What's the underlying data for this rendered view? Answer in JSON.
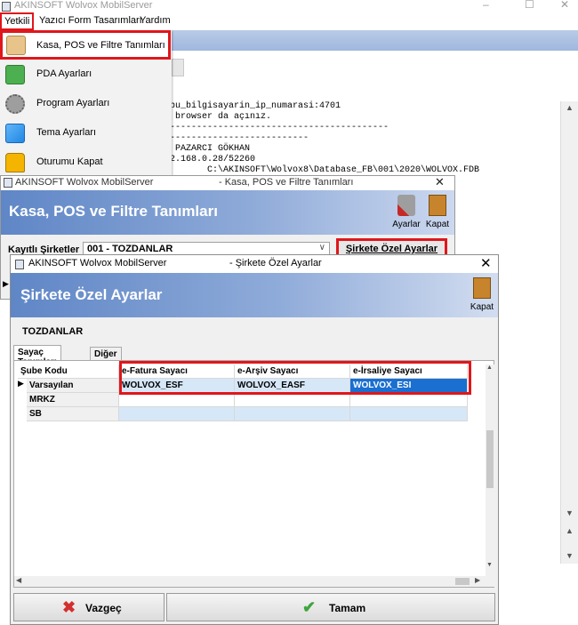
{
  "main_window": {
    "title": "AKINSOFT Wolvox MobilServer",
    "menu": [
      "Yetkili",
      "Yazıcı Form Tasarımları",
      "Yardım"
    ],
    "log_lines": [
      "/bu_bilgisayarin_ip_numarasi:4701",
      "p browser da açınız.",
      "------------------------------------------",
      "---------------------------",
      ": PAZARCI GÖKHAN",
      "92.168.0.28/52260",
      "        C:\\AKINSOFT\\Wolvox8\\Database_FB\\001\\2020\\WOLVOX.FDB"
    ]
  },
  "dropdown": {
    "items": [
      {
        "label": "Kasa,  POS ve Filtre Tanımları",
        "icon": "cashier-icon"
      },
      {
        "label": "PDA Ayarları",
        "icon": "pda-icon"
      },
      {
        "label": "Program Ayarları",
        "icon": "gears-icon"
      },
      {
        "label": "Tema Ayarları",
        "icon": "palette-icon"
      },
      {
        "label": "Oturumu Kapat",
        "icon": "padlock-icon"
      }
    ]
  },
  "kasa_window": {
    "app_title": "AKINSOFT Wolvox MobilServer",
    "window_title": "- Kasa,  POS ve Filtre Tanımları",
    "heading": "Kasa,  POS ve Filtre Tanımları",
    "tool_ayarlar": "Ayarlar",
    "tool_kapat": "Kapat",
    "company_label": "Kayıtlı Şirketler",
    "company_value": "001 - TOZDANLAR",
    "special_settings_button": "Şirkete Özel Ayarlar"
  },
  "dialog": {
    "app_title": "AKINSOFT Wolvox MobilServer",
    "window_title": "- Şirkete Özel Ayarlar",
    "heading": "Şirkete Özel Ayarlar",
    "tool_kapat": "Kapat",
    "company": "TOZDANLAR",
    "tabs": [
      "Sayaç Tanımları",
      "Diğer"
    ],
    "grid": {
      "columns": [
        "Şube Kodu",
        "e-Fatura Sayacı",
        "e-Arşiv Sayacı",
        "e-İrsaliye Sayacı"
      ],
      "rows": [
        {
          "sube": "Varsayılan",
          "fatura": "WOLVOX_ESF",
          "arsiv": "WOLVOX_EASF",
          "irsaliye": "WOLVOX_ESI"
        },
        {
          "sube": "MRKZ",
          "fatura": "",
          "arsiv": "",
          "irsaliye": ""
        },
        {
          "sube": "SB",
          "fatura": "",
          "arsiv": "",
          "irsaliye": ""
        }
      ]
    },
    "cancel_button": "Vazgeç",
    "ok_button": "Tamam"
  },
  "colors": {
    "highlight_red": "#e0161b",
    "header_blue": "#5f86c6",
    "selected_cell": "#1a6fd0"
  }
}
